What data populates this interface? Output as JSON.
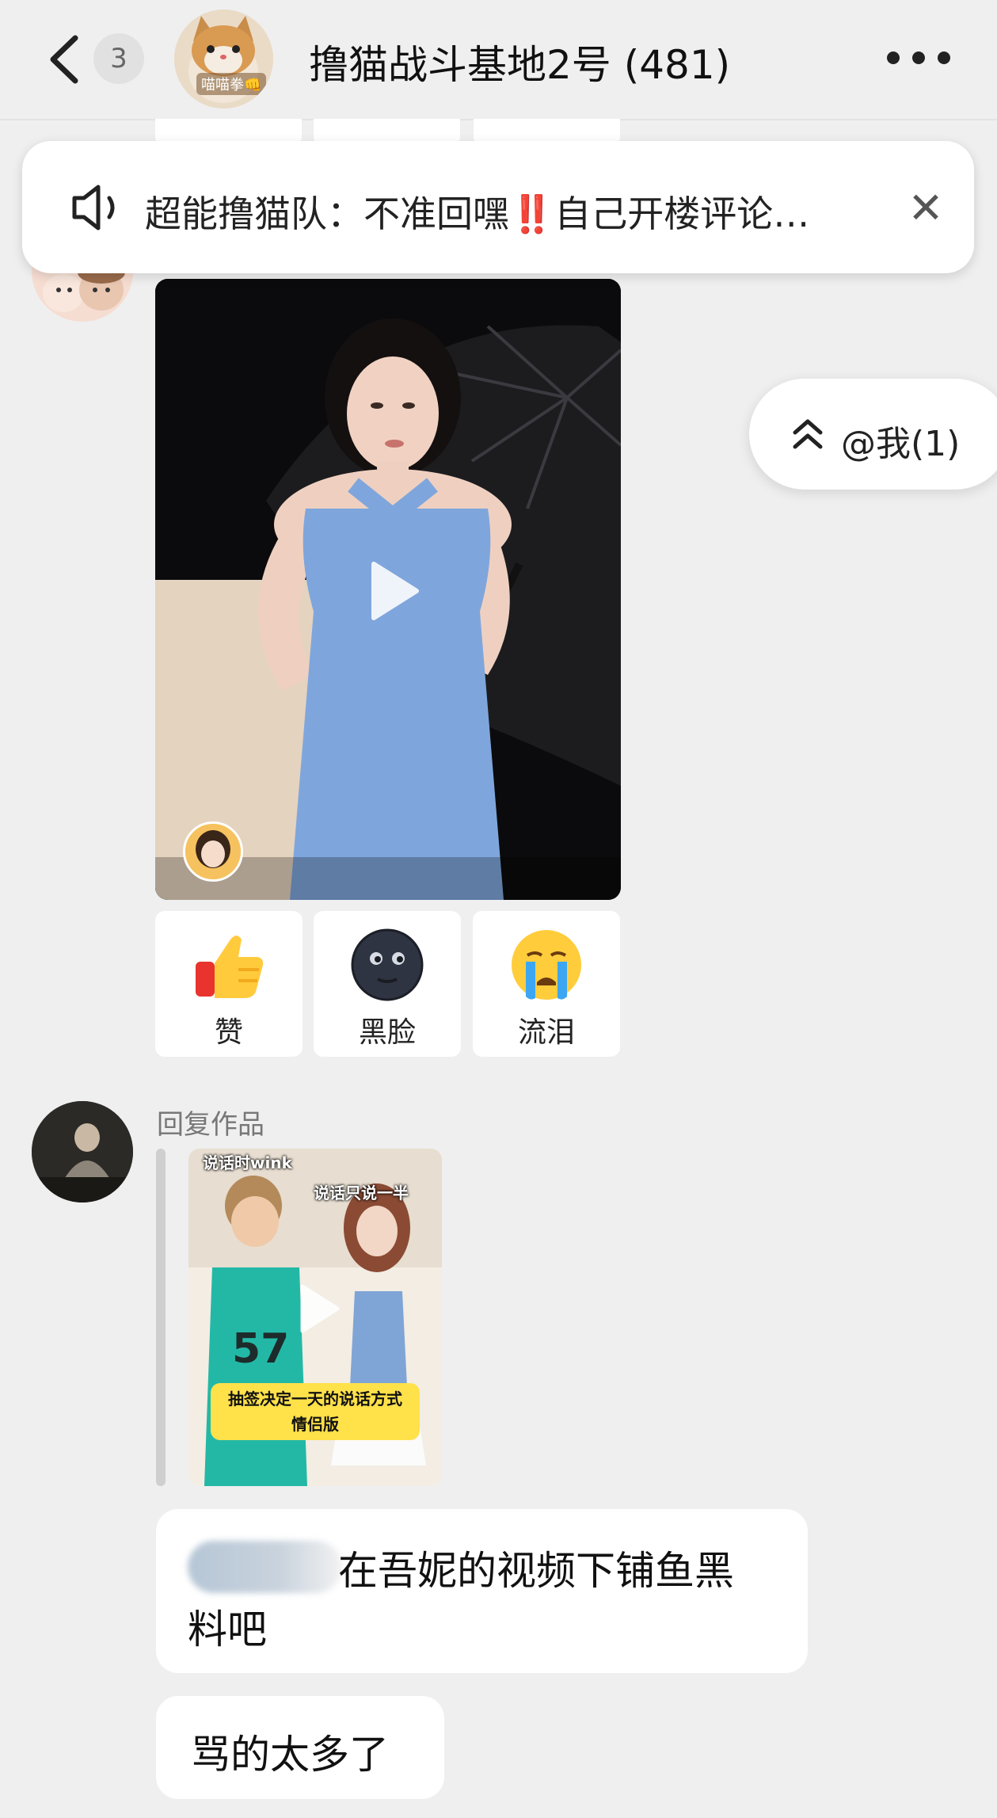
{
  "header": {
    "back_icon": "chevron-left-icon",
    "unread_count": "3",
    "group_avatar_label": "喵喵拳👊",
    "title": "撸猫战斗基地2号 (481)",
    "more_icon": "more-horizontal-icon"
  },
  "announcement": {
    "icon": "speaker-icon",
    "text": "超能撸猫队：不准回嘿‼️自己开楼评论…",
    "close_icon": "close-icon",
    "close_symbol": "✕"
  },
  "at_me": {
    "icon": "double-chevron-up-icon",
    "label": "@我(1)"
  },
  "video_post": {
    "play_icon": "play-icon"
  },
  "reactions": [
    {
      "emoji": "thumbs-up-icon",
      "label": "赞"
    },
    {
      "emoji": "dark-moon-face-icon",
      "label": "黑脸"
    },
    {
      "emoji": "crying-face-icon",
      "label": "流泪"
    }
  ],
  "reply_work": {
    "label": "回复作品",
    "tag_left": "说话时wink",
    "tag_right": "说话只说一半",
    "caption_line1": "抽签决定一天的说话方式",
    "caption_line2": "情侣版",
    "play_icon": "play-icon"
  },
  "messages": [
    {
      "line1": "在吾妮的视频下铺鱼黑",
      "line2": "料吧"
    },
    {
      "text": "骂的太多了"
    }
  ],
  "colors": {
    "background": "#efefef",
    "bubble": "#ffffff",
    "caption_yellow": "#ffe14a"
  }
}
